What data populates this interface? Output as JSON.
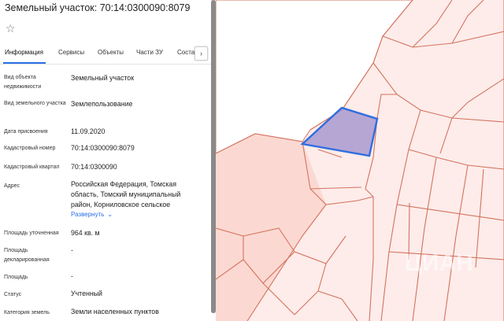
{
  "panel": {
    "title": "Земельный участок: 70:14:0300090:8079",
    "star_icon": "star-icon",
    "tabs": [
      {
        "label": "Информация",
        "active": true
      },
      {
        "label": "Сервисы"
      },
      {
        "label": "Объекты"
      },
      {
        "label": "Части ЗУ"
      },
      {
        "label": "Соста"
      }
    ],
    "tab_next_glyph": "›",
    "fields": {
      "object_type": {
        "label": "Вид объекта недвижимости",
        "value": "Земельный участок"
      },
      "land_use": {
        "label": "Вид земельного участка",
        "value": "Землепользование"
      },
      "assign_date": {
        "label": "Дата присвоения",
        "value": "11.09.2020"
      },
      "cadastral_number": {
        "label": "Кадастровый номер",
        "value": "70:14:0300090:8079"
      },
      "cadastral_quarter": {
        "label": "Кадастровый квартал",
        "value": "70:14:0300090"
      },
      "address": {
        "label": "Адрес",
        "value": "Российская Федерация, Томская область, Томский муниципальный район, Корниловское сельское",
        "expand_label": "Развернуть"
      },
      "area_refined": {
        "label": "Площадь уточненная",
        "value": "964 кв. м"
      },
      "area_declared": {
        "label": "Площадь декларированная",
        "value": "-"
      },
      "area": {
        "label": "Площадь",
        "value": "-"
      },
      "status": {
        "label": "Статус",
        "value": "Учтенный"
      },
      "land_category": {
        "label": "Категория земель",
        "value": "Земли населенных пунктов"
      }
    }
  },
  "map": {
    "fill_color": "#fbd9d2",
    "line_color": "#d4735e",
    "highlight_fill": "#a89ad0",
    "highlight_stroke": "#2e6de0",
    "watermarks": [
      "ЦИАН"
    ]
  }
}
